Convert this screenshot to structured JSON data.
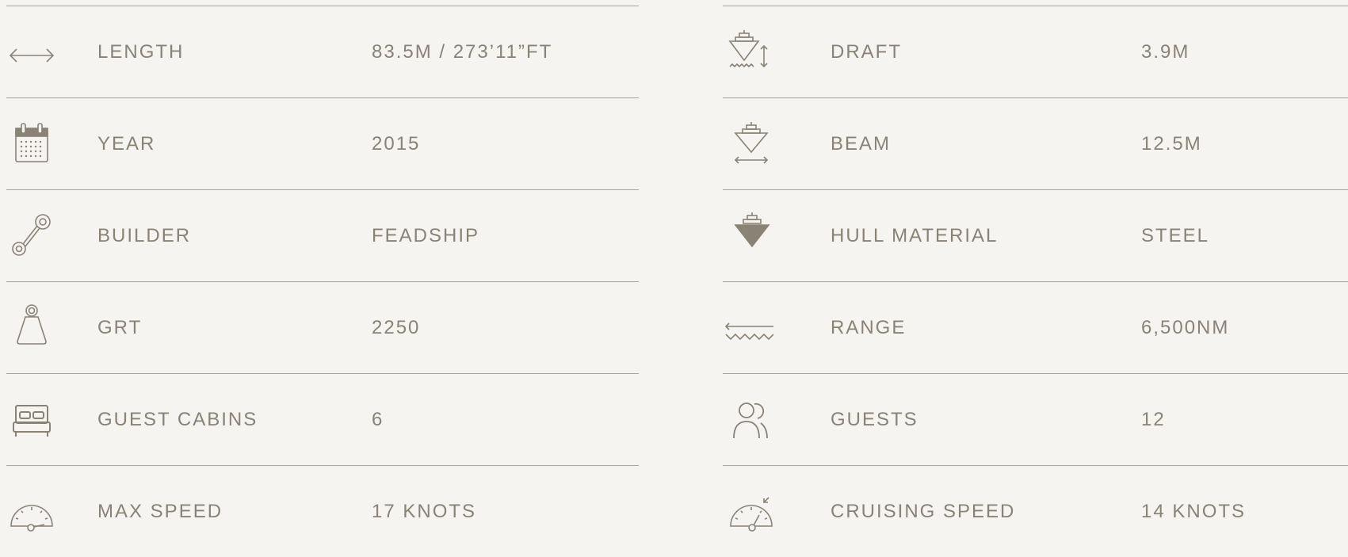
{
  "specs": {
    "left": [
      {
        "icon": "double-arrow-icon",
        "label": "LENGTH",
        "value": "83.5M / 273’11”FT"
      },
      {
        "icon": "calendar-icon",
        "label": "YEAR",
        "value": "2015"
      },
      {
        "icon": "wrench-icon",
        "label": "BUILDER",
        "value": "FEADSHIP"
      },
      {
        "icon": "weight-icon",
        "label": "GRT",
        "value": "2250"
      },
      {
        "icon": "bed-icon",
        "label": "GUEST CABINS",
        "value": "6"
      },
      {
        "icon": "speedometer-icon",
        "label": "MAX SPEED",
        "value": "17 KNOTS"
      }
    ],
    "right": [
      {
        "icon": "ship-draft-icon",
        "label": "DRAFT",
        "value": "3.9M"
      },
      {
        "icon": "ship-beam-icon",
        "label": "BEAM",
        "value": "12.5M"
      },
      {
        "icon": "ship-hull-icon",
        "label": "HULL MATERIAL",
        "value": "STEEL"
      },
      {
        "icon": "range-waves-icon",
        "label": "RANGE",
        "value": "6,500NM"
      },
      {
        "icon": "guests-icon",
        "label": "GUESTS",
        "value": "12"
      },
      {
        "icon": "cruising-gauge-icon",
        "label": "CRUISING SPEED",
        "value": "14 KNOTS"
      }
    ]
  },
  "colors": {
    "text": "#8a8275",
    "divider": "#a9a49c",
    "background": "#f5f4f1"
  }
}
